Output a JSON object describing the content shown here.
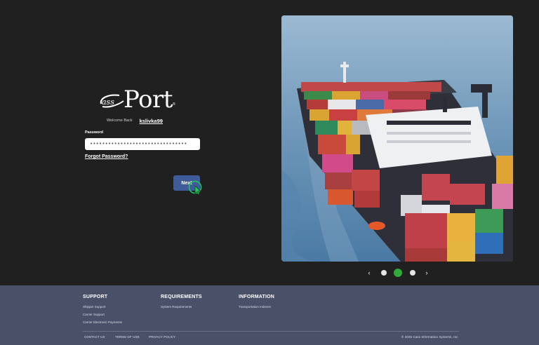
{
  "brand": {
    "logo_text": "Port",
    "logo_cass": "cass"
  },
  "login": {
    "welcome_label": "Welcome Back",
    "username": "kslivka99",
    "password_label": "Password",
    "password_value": "••••••••••••••••••••••••••••••••",
    "forgot_password": "Forgot Password?",
    "next_button": "Next"
  },
  "carousel": {
    "prev_icon": "chevron-left-icon",
    "next_icon": "chevron-right-icon",
    "slide_count": 3,
    "active_index": 1
  },
  "footer": {
    "support": {
      "title": "SUPPORT",
      "links": [
        "Shipper Support",
        "Carrier Support",
        "Carrier Electronic Payments"
      ]
    },
    "requirements": {
      "title": "REQUIREMENTS",
      "links": [
        "System Requirements"
      ]
    },
    "information": {
      "title": "INFORMATION",
      "links": [
        "Transportation Indexes"
      ]
    },
    "bottom_links": [
      "CONTACT US",
      "TERMS OF USE",
      "PRIVACY POLICY"
    ],
    "copyright": "© 2025 Cass Information Systems, Inc"
  },
  "colors": {
    "background": "#202020",
    "button": "#3f5c9a",
    "carousel_active": "#2faa3b",
    "footer": "#4a5068"
  }
}
